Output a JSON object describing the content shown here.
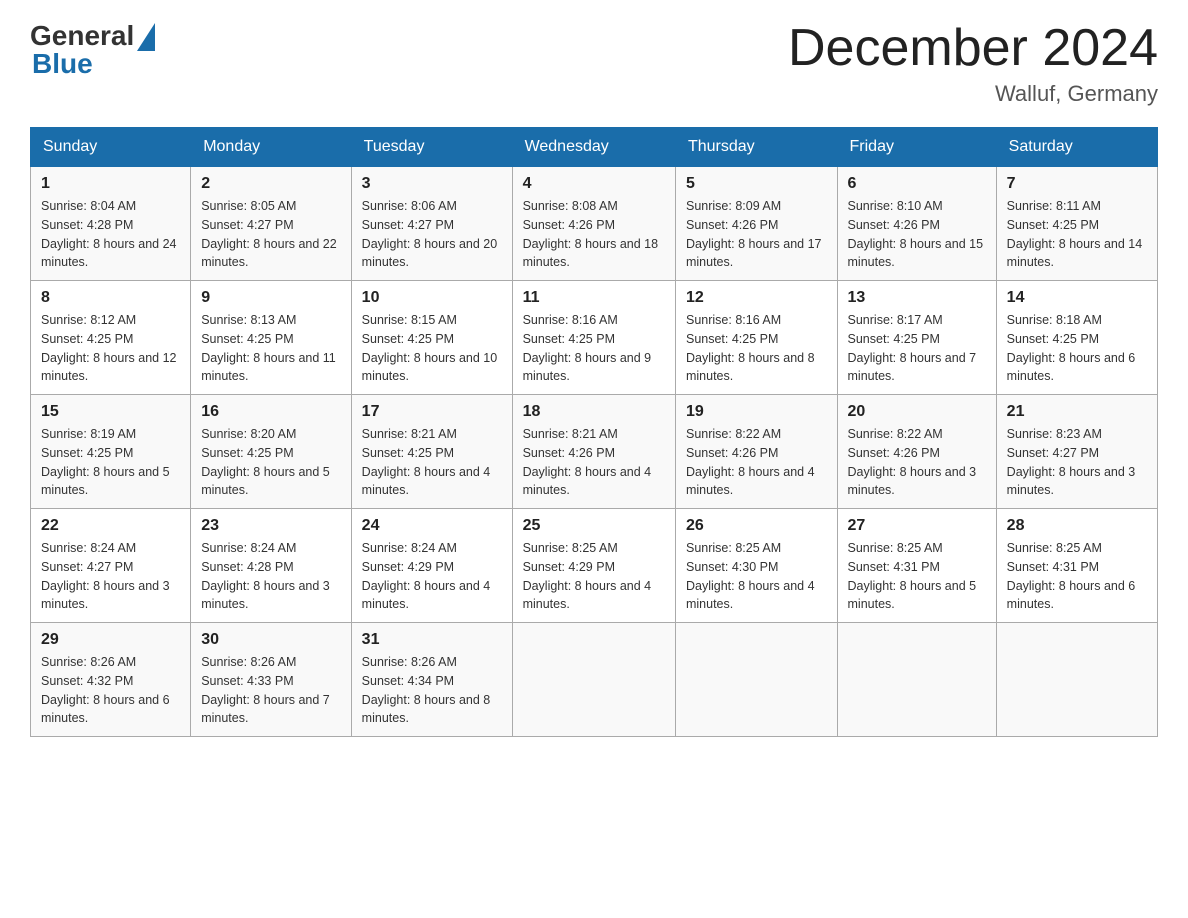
{
  "header": {
    "logo_general": "General",
    "logo_blue": "Blue",
    "title": "December 2024",
    "subtitle": "Walluf, Germany"
  },
  "days_of_week": [
    "Sunday",
    "Monday",
    "Tuesday",
    "Wednesday",
    "Thursday",
    "Friday",
    "Saturday"
  ],
  "weeks": [
    [
      {
        "num": "1",
        "sunrise": "8:04 AM",
        "sunset": "4:28 PM",
        "daylight": "8 hours and 24 minutes."
      },
      {
        "num": "2",
        "sunrise": "8:05 AM",
        "sunset": "4:27 PM",
        "daylight": "8 hours and 22 minutes."
      },
      {
        "num": "3",
        "sunrise": "8:06 AM",
        "sunset": "4:27 PM",
        "daylight": "8 hours and 20 minutes."
      },
      {
        "num": "4",
        "sunrise": "8:08 AM",
        "sunset": "4:26 PM",
        "daylight": "8 hours and 18 minutes."
      },
      {
        "num": "5",
        "sunrise": "8:09 AM",
        "sunset": "4:26 PM",
        "daylight": "8 hours and 17 minutes."
      },
      {
        "num": "6",
        "sunrise": "8:10 AM",
        "sunset": "4:26 PM",
        "daylight": "8 hours and 15 minutes."
      },
      {
        "num": "7",
        "sunrise": "8:11 AM",
        "sunset": "4:25 PM",
        "daylight": "8 hours and 14 minutes."
      }
    ],
    [
      {
        "num": "8",
        "sunrise": "8:12 AM",
        "sunset": "4:25 PM",
        "daylight": "8 hours and 12 minutes."
      },
      {
        "num": "9",
        "sunrise": "8:13 AM",
        "sunset": "4:25 PM",
        "daylight": "8 hours and 11 minutes."
      },
      {
        "num": "10",
        "sunrise": "8:15 AM",
        "sunset": "4:25 PM",
        "daylight": "8 hours and 10 minutes."
      },
      {
        "num": "11",
        "sunrise": "8:16 AM",
        "sunset": "4:25 PM",
        "daylight": "8 hours and 9 minutes."
      },
      {
        "num": "12",
        "sunrise": "8:16 AM",
        "sunset": "4:25 PM",
        "daylight": "8 hours and 8 minutes."
      },
      {
        "num": "13",
        "sunrise": "8:17 AM",
        "sunset": "4:25 PM",
        "daylight": "8 hours and 7 minutes."
      },
      {
        "num": "14",
        "sunrise": "8:18 AM",
        "sunset": "4:25 PM",
        "daylight": "8 hours and 6 minutes."
      }
    ],
    [
      {
        "num": "15",
        "sunrise": "8:19 AM",
        "sunset": "4:25 PM",
        "daylight": "8 hours and 5 minutes."
      },
      {
        "num": "16",
        "sunrise": "8:20 AM",
        "sunset": "4:25 PM",
        "daylight": "8 hours and 5 minutes."
      },
      {
        "num": "17",
        "sunrise": "8:21 AM",
        "sunset": "4:25 PM",
        "daylight": "8 hours and 4 minutes."
      },
      {
        "num": "18",
        "sunrise": "8:21 AM",
        "sunset": "4:26 PM",
        "daylight": "8 hours and 4 minutes."
      },
      {
        "num": "19",
        "sunrise": "8:22 AM",
        "sunset": "4:26 PM",
        "daylight": "8 hours and 4 minutes."
      },
      {
        "num": "20",
        "sunrise": "8:22 AM",
        "sunset": "4:26 PM",
        "daylight": "8 hours and 3 minutes."
      },
      {
        "num": "21",
        "sunrise": "8:23 AM",
        "sunset": "4:27 PM",
        "daylight": "8 hours and 3 minutes."
      }
    ],
    [
      {
        "num": "22",
        "sunrise": "8:24 AM",
        "sunset": "4:27 PM",
        "daylight": "8 hours and 3 minutes."
      },
      {
        "num": "23",
        "sunrise": "8:24 AM",
        "sunset": "4:28 PM",
        "daylight": "8 hours and 3 minutes."
      },
      {
        "num": "24",
        "sunrise": "8:24 AM",
        "sunset": "4:29 PM",
        "daylight": "8 hours and 4 minutes."
      },
      {
        "num": "25",
        "sunrise": "8:25 AM",
        "sunset": "4:29 PM",
        "daylight": "8 hours and 4 minutes."
      },
      {
        "num": "26",
        "sunrise": "8:25 AM",
        "sunset": "4:30 PM",
        "daylight": "8 hours and 4 minutes."
      },
      {
        "num": "27",
        "sunrise": "8:25 AM",
        "sunset": "4:31 PM",
        "daylight": "8 hours and 5 minutes."
      },
      {
        "num": "28",
        "sunrise": "8:25 AM",
        "sunset": "4:31 PM",
        "daylight": "8 hours and 6 minutes."
      }
    ],
    [
      {
        "num": "29",
        "sunrise": "8:26 AM",
        "sunset": "4:32 PM",
        "daylight": "8 hours and 6 minutes."
      },
      {
        "num": "30",
        "sunrise": "8:26 AM",
        "sunset": "4:33 PM",
        "daylight": "8 hours and 7 minutes."
      },
      {
        "num": "31",
        "sunrise": "8:26 AM",
        "sunset": "4:34 PM",
        "daylight": "8 hours and 8 minutes."
      },
      null,
      null,
      null,
      null
    ]
  ]
}
